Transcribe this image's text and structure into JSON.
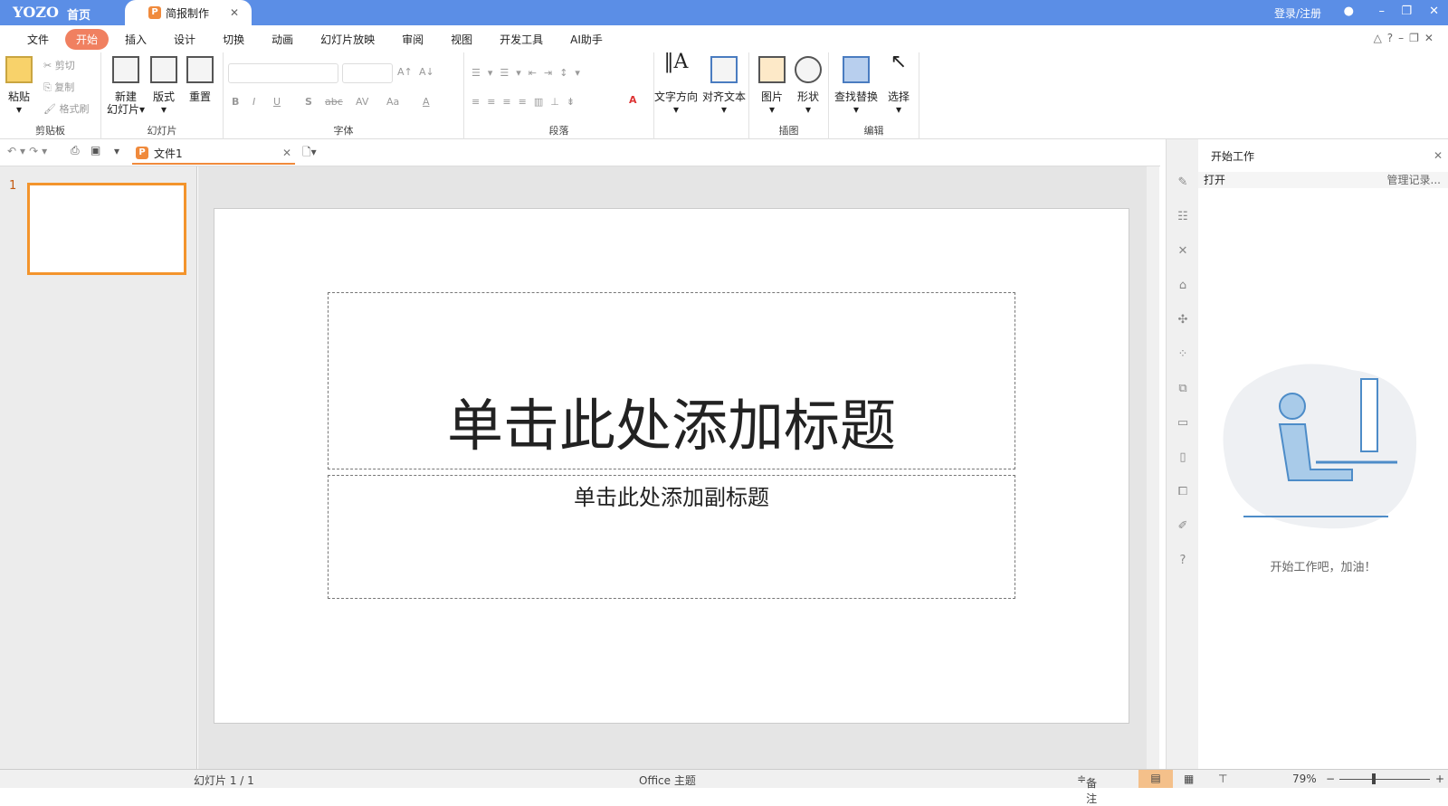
{
  "titlebar": {
    "logo": "YOZO",
    "home": "首页",
    "tab": "简报制作",
    "tab_icon": "P",
    "login": "登录/注册"
  },
  "menu": [
    "文件",
    "开始",
    "插入",
    "设计",
    "切换",
    "动画",
    "幻灯片放映",
    "审阅",
    "视图",
    "开发工具",
    "AI助手"
  ],
  "ribbon": {
    "clipboard": {
      "label": "剪贴板",
      "paste": "粘贴",
      "cut": "剪切",
      "copy": "复制",
      "format_painter": "格式刷"
    },
    "slides": {
      "label": "幻灯片",
      "new": "新建",
      "new2": "幻灯片",
      "layout": "版式",
      "reset": "重置"
    },
    "font": {
      "label": "字体",
      "bold": "B",
      "italic": "I",
      "underline": "U",
      "shadow": "S",
      "strike": "abc",
      "spacing": "AV",
      "case": "Aa",
      "color": "A",
      "grow": "A↑",
      "shrink": "A↓"
    },
    "paragraph": {
      "label": "段落",
      "text_direction": "文字方向",
      "align_text": "对齐文本"
    },
    "illustration": {
      "label": "插图",
      "picture": "图片",
      "shape": "形状"
    },
    "edit": {
      "label": "编辑",
      "find_replace": "查找替换",
      "select": "选择"
    }
  },
  "quickbar": {
    "file_tab": "文件1"
  },
  "slides_pane": {
    "slide_number": "1"
  },
  "slide": {
    "title_placeholder": "单击此处添加标题",
    "subtitle_placeholder": "单击此处添加副标题"
  },
  "taskpane": {
    "title": "开始工作",
    "open": "打开",
    "manage": "管理记录...",
    "message": "开始工作吧，加油！"
  },
  "status": {
    "slide_counter": "幻灯片 1 / 1",
    "theme": "Office 主题",
    "notes": "备注",
    "zoom": "79%"
  },
  "colors": {
    "titlebar": "#5b8ee6",
    "accent": "#f08060",
    "selection": "#f3942c"
  }
}
